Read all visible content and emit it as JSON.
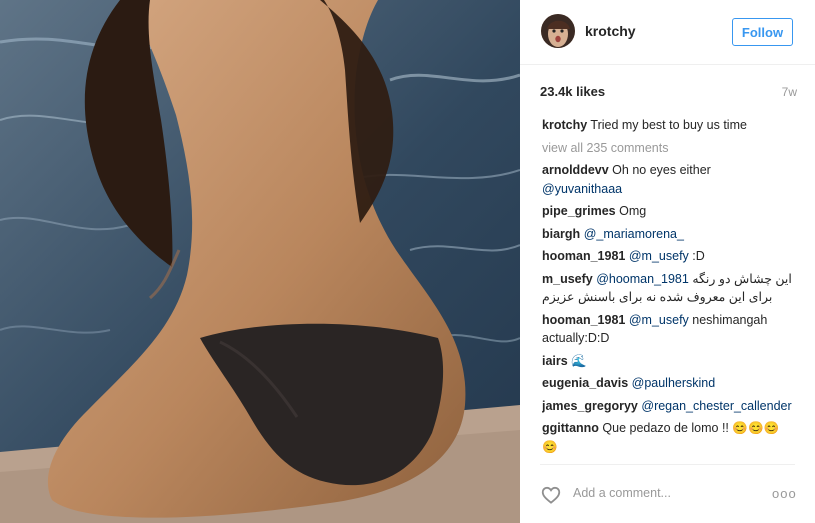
{
  "post": {
    "username": "krotchy",
    "follow_label": "Follow",
    "likes": "23.4k likes",
    "age": "7w",
    "caption_user": "krotchy",
    "caption_text": "Tried my best to buy us time",
    "view_all": "view all 235 comments",
    "add_comment_placeholder": "Add a comment...",
    "more_label": "ooo"
  },
  "comments": [
    {
      "user": "arnolddevv",
      "text": "Oh no eyes either",
      "mention": "@yuvanithaaa"
    },
    {
      "user": "pipe_grimes",
      "text": "Omg"
    },
    {
      "user": "biargh",
      "mention": "@_mariamorena_"
    },
    {
      "user": "hooman_1981",
      "mention": "@m_usefy",
      "text": ":D"
    },
    {
      "user": "m_usefy",
      "mention": "@hooman_1981",
      "text": "این چشاش دو رنگه",
      "text2": "برای این معروف شده نه برای باسنش عزیزم"
    },
    {
      "user": "hooman_1981",
      "mention": "@m_usefy",
      "text": "neshimangah actually:D:D"
    },
    {
      "user": "iairs",
      "text": "🌊"
    },
    {
      "user": "eugenia_davis",
      "mention": "@paulherskind"
    },
    {
      "user": "james_gregoryy",
      "mention": "@regan_chester_callender"
    },
    {
      "user": "ggittanno",
      "text": "Que pedazo de lomo !!",
      "emoji": "😊😊😊😊"
    }
  ]
}
